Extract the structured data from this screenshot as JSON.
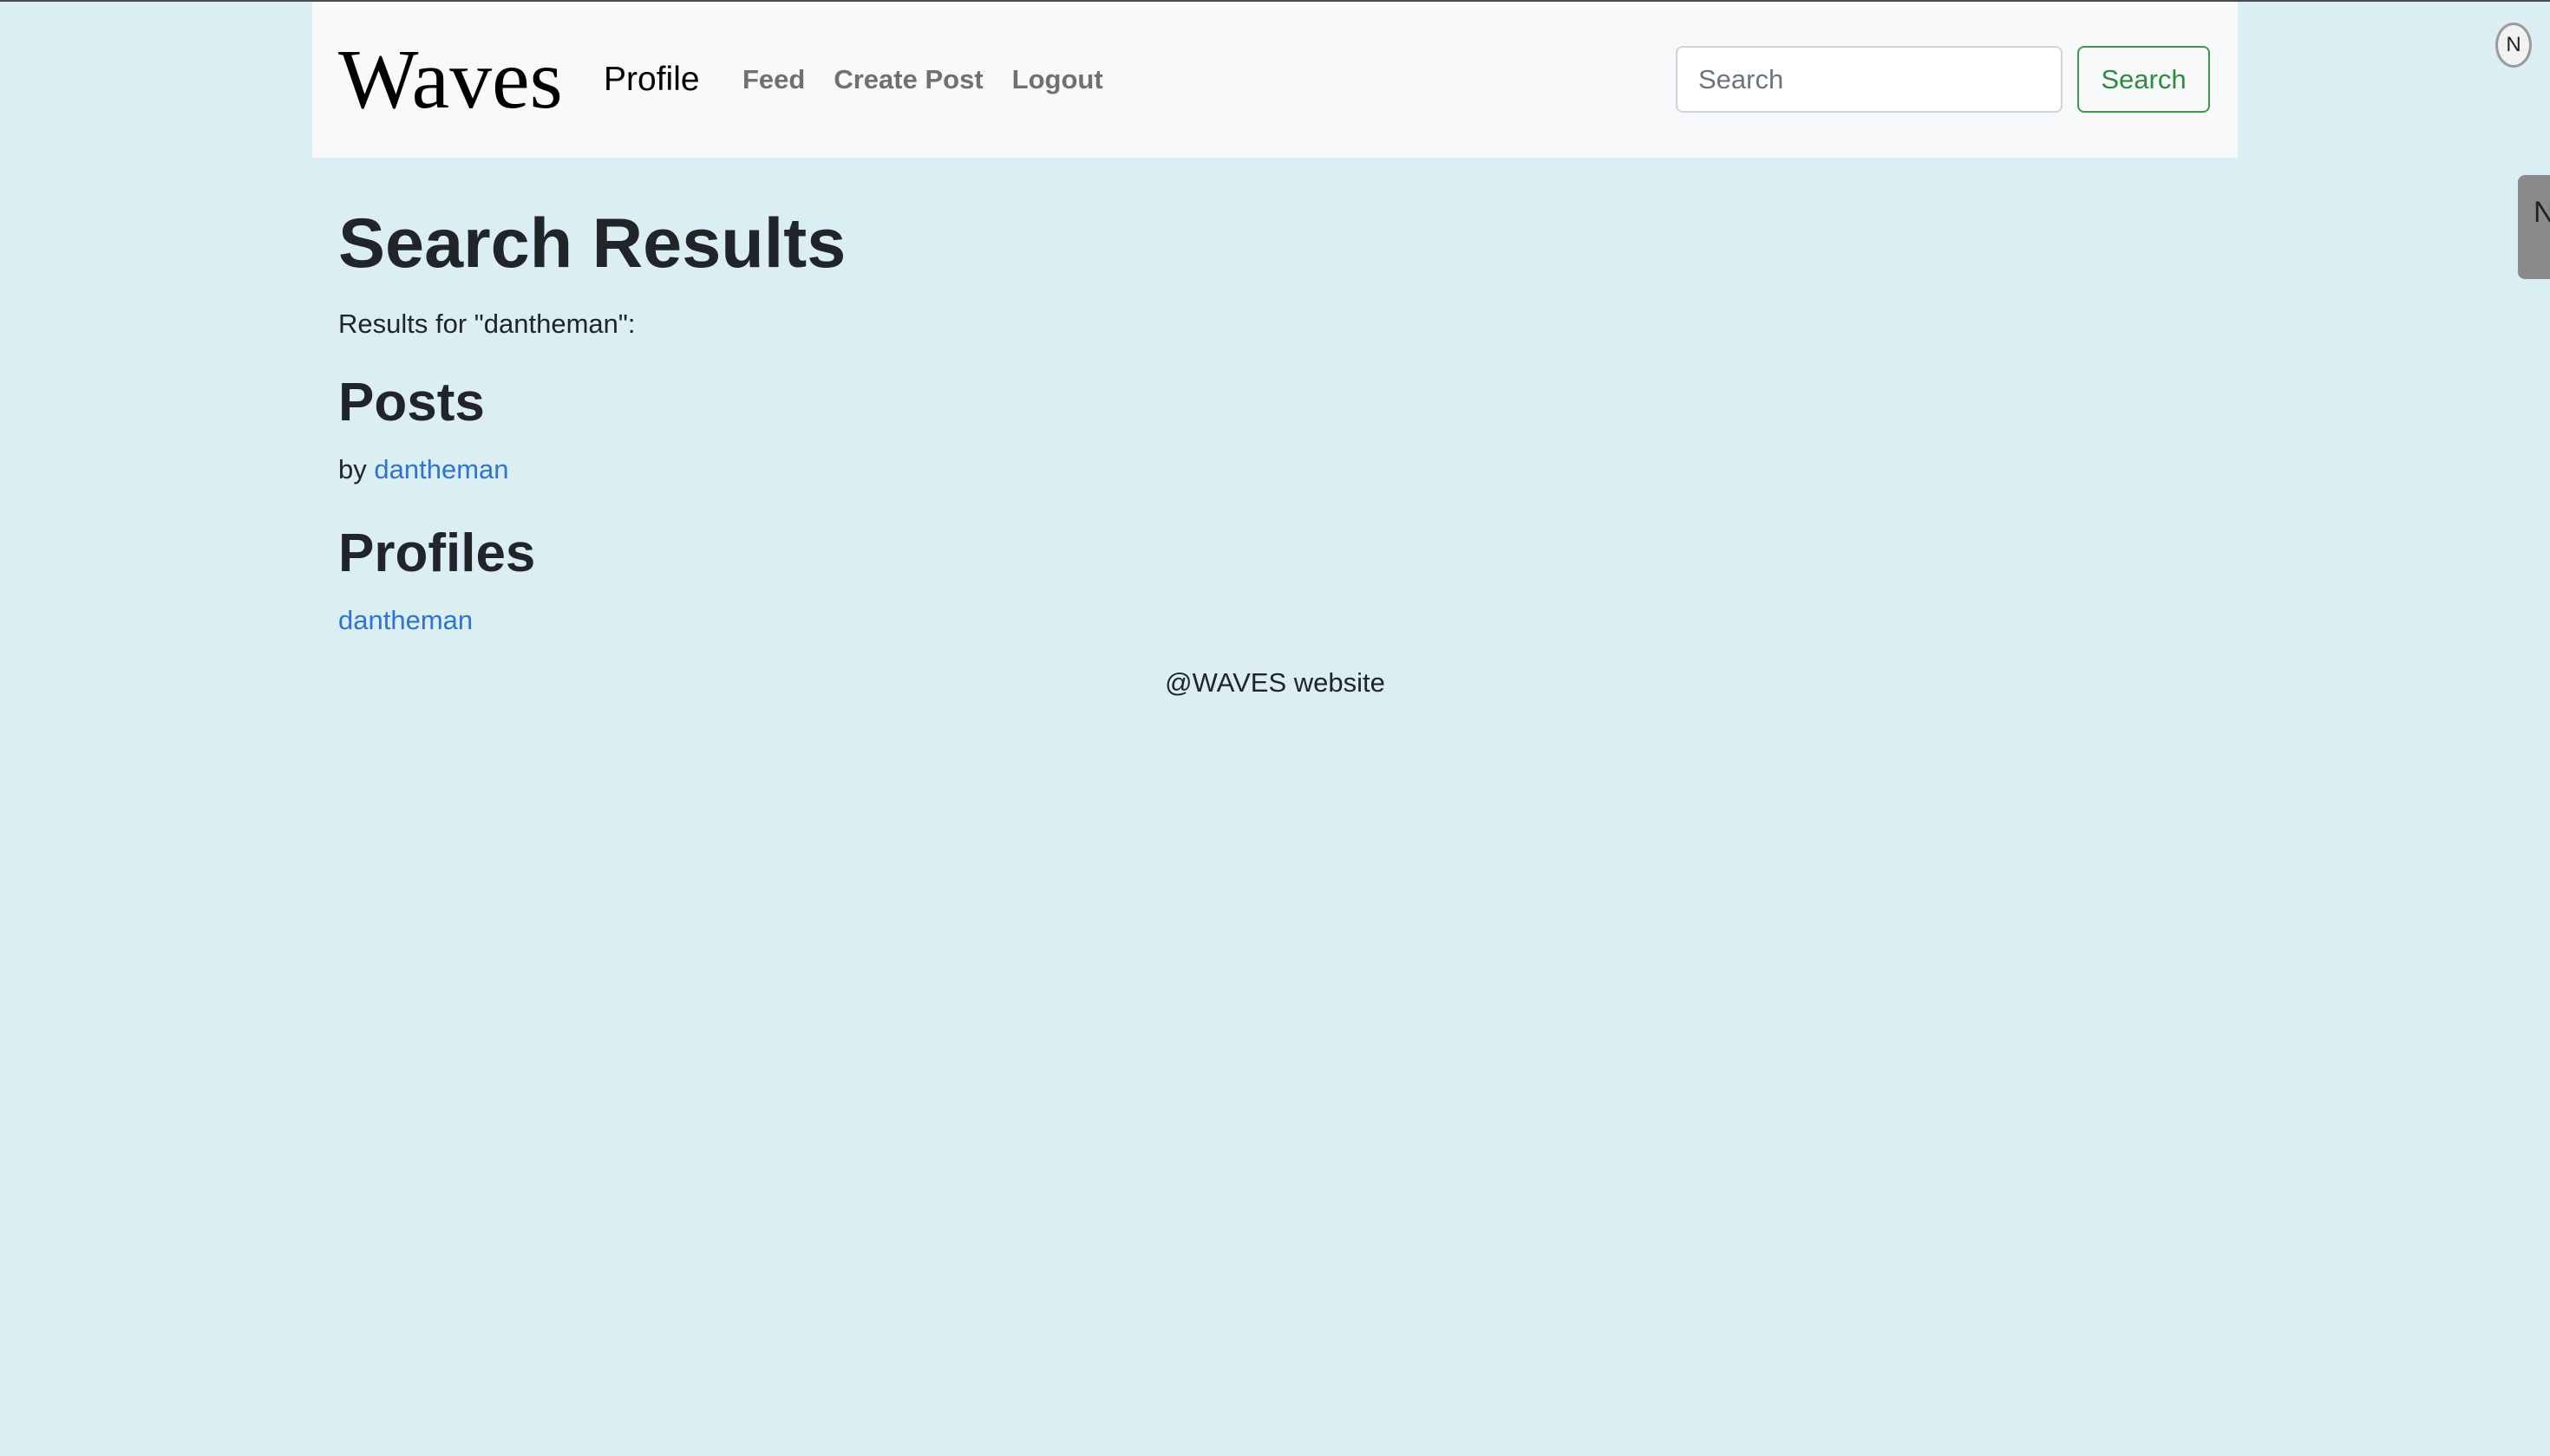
{
  "nav": {
    "brand": "Waves",
    "profile": "Profile",
    "links": [
      "Feed",
      "Create Post",
      "Logout"
    ],
    "search_placeholder": "Search",
    "search_button": "Search"
  },
  "overlay": {
    "avatar_letter": "N",
    "side_tab_letter": "N"
  },
  "main": {
    "title": "Search Results",
    "results_for": "Results for \"dantheman\":",
    "posts_heading": "Posts",
    "post_by": "by",
    "post_author": "dantheman",
    "profiles_heading": "Profiles",
    "profile_result": "dantheman"
  },
  "footer": {
    "text": "@WAVES website"
  },
  "colors": {
    "page_background": "#dbeef3",
    "navbar_background": "#f8f9fa",
    "link": "#2f74d0",
    "search_button": "#2e8b3f"
  }
}
